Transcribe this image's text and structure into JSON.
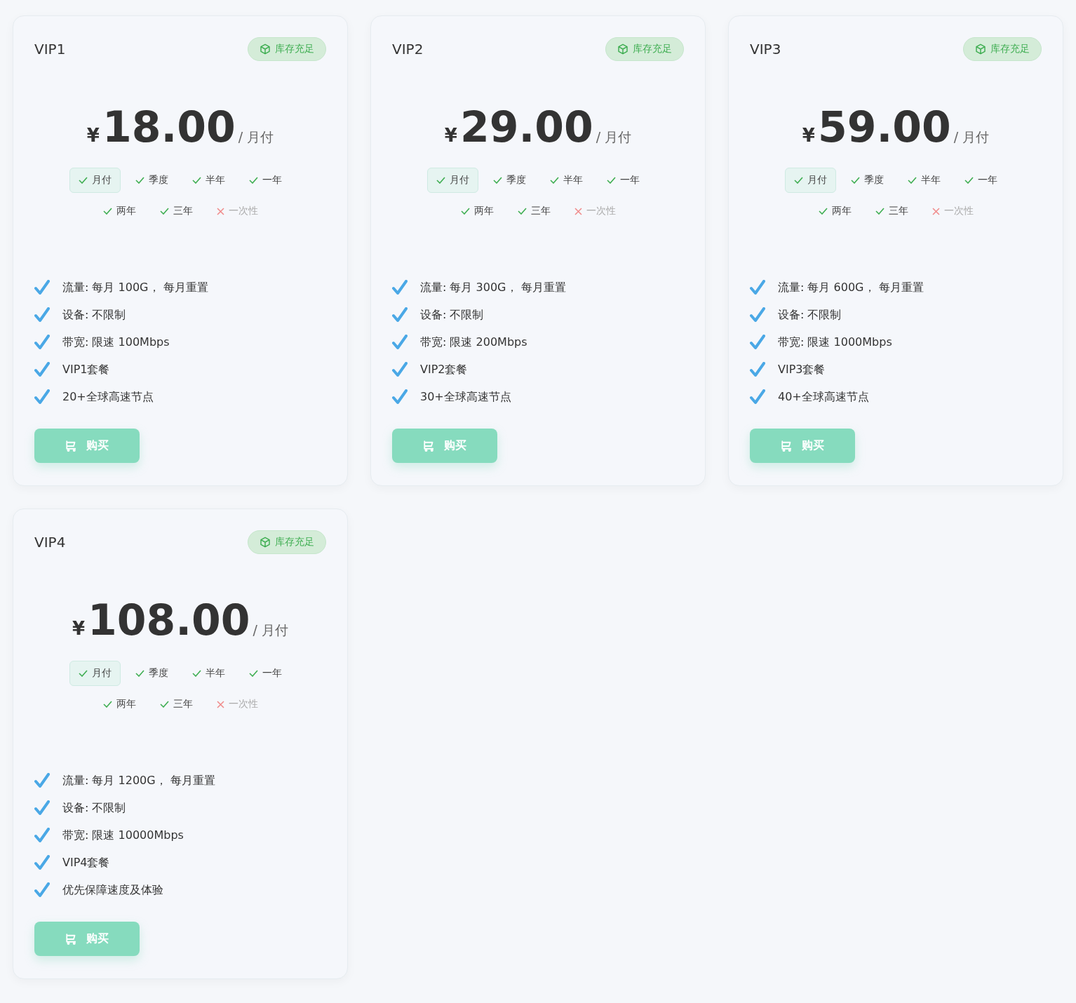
{
  "plans": [
    {
      "name": "VIP1",
      "stock": "库存充足",
      "currency": "¥",
      "price": "18.00",
      "unit": "/ 月付",
      "periods": [
        {
          "label": "月付",
          "available": true,
          "selected": true
        },
        {
          "label": "季度",
          "available": true,
          "selected": false
        },
        {
          "label": "半年",
          "available": true,
          "selected": false
        },
        {
          "label": "一年",
          "available": true,
          "selected": false
        },
        {
          "label": "两年",
          "available": true,
          "selected": false
        },
        {
          "label": "三年",
          "available": true,
          "selected": false
        },
        {
          "label": "一次性",
          "available": false,
          "selected": false
        }
      ],
      "features": [
        "流量: 每月 100G， 每月重置",
        "设备: 不限制",
        "带宽: 限速 100Mbps",
        "VIP1套餐",
        "20+全球高速节点"
      ],
      "buy": "购买"
    },
    {
      "name": "VIP2",
      "stock": "库存充足",
      "currency": "¥",
      "price": "29.00",
      "unit": "/ 月付",
      "periods": [
        {
          "label": "月付",
          "available": true,
          "selected": true
        },
        {
          "label": "季度",
          "available": true,
          "selected": false
        },
        {
          "label": "半年",
          "available": true,
          "selected": false
        },
        {
          "label": "一年",
          "available": true,
          "selected": false
        },
        {
          "label": "两年",
          "available": true,
          "selected": false
        },
        {
          "label": "三年",
          "available": true,
          "selected": false
        },
        {
          "label": "一次性",
          "available": false,
          "selected": false
        }
      ],
      "features": [
        "流量: 每月 300G， 每月重置",
        "设备: 不限制",
        "带宽: 限速 200Mbps",
        "VIP2套餐",
        "30+全球高速节点"
      ],
      "buy": "购买"
    },
    {
      "name": "VIP3",
      "stock": "库存充足",
      "currency": "¥",
      "price": "59.00",
      "unit": "/ 月付",
      "periods": [
        {
          "label": "月付",
          "available": true,
          "selected": true
        },
        {
          "label": "季度",
          "available": true,
          "selected": false
        },
        {
          "label": "半年",
          "available": true,
          "selected": false
        },
        {
          "label": "一年",
          "available": true,
          "selected": false
        },
        {
          "label": "两年",
          "available": true,
          "selected": false
        },
        {
          "label": "三年",
          "available": true,
          "selected": false
        },
        {
          "label": "一次性",
          "available": false,
          "selected": false
        }
      ],
      "features": [
        "流量: 每月 600G， 每月重置",
        "设备: 不限制",
        "带宽: 限速 1000Mbps",
        "VIP3套餐",
        "40+全球高速节点"
      ],
      "buy": "购买"
    },
    {
      "name": "VIP4",
      "stock": "库存充足",
      "currency": "¥",
      "price": "108.00",
      "unit": "/ 月付",
      "periods": [
        {
          "label": "月付",
          "available": true,
          "selected": true
        },
        {
          "label": "季度",
          "available": true,
          "selected": false
        },
        {
          "label": "半年",
          "available": true,
          "selected": false
        },
        {
          "label": "一年",
          "available": true,
          "selected": false
        },
        {
          "label": "两年",
          "available": true,
          "selected": false
        },
        {
          "label": "三年",
          "available": true,
          "selected": false
        },
        {
          "label": "一次性",
          "available": false,
          "selected": false
        }
      ],
      "features": [
        "流量: 每月 1200G， 每月重置",
        "设备: 不限制",
        "带宽: 限速 10000Mbps",
        "VIP4套餐",
        "优先保障速度及体验"
      ],
      "buy": "购买"
    }
  ]
}
